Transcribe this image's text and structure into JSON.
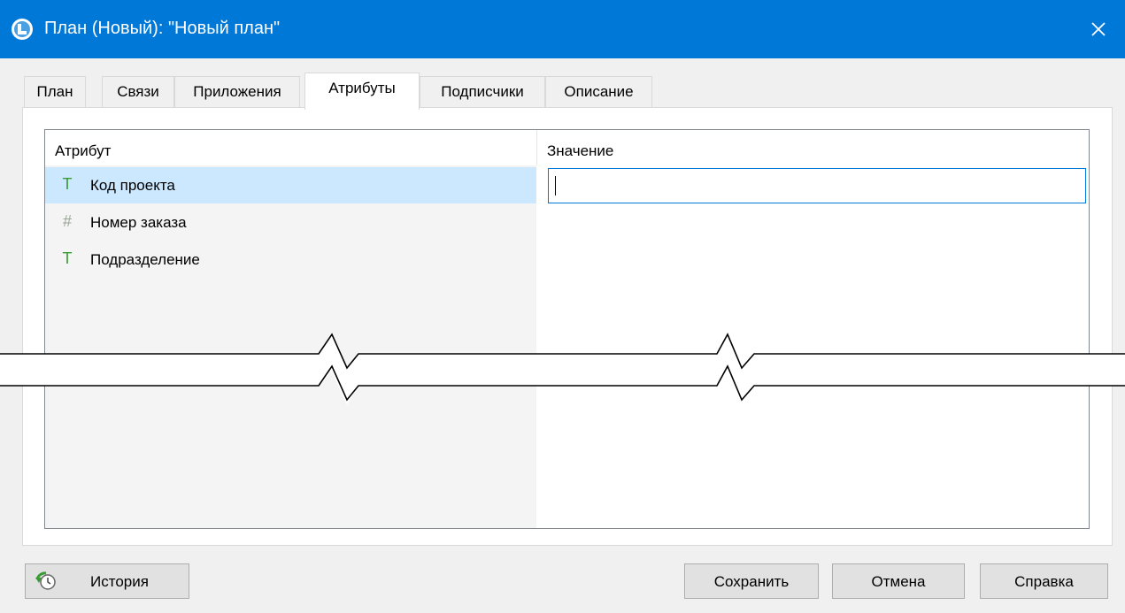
{
  "window": {
    "title": "План (Новый): \"Новый план\"",
    "icon": "app-logo-icon",
    "close_icon": "close-icon",
    "accent_color": "#0078d7"
  },
  "tabs": [
    {
      "label": "План",
      "active": false
    },
    {
      "label": "Связи",
      "active": false
    },
    {
      "label": "Приложения",
      "active": false
    },
    {
      "label": "Атрибуты",
      "active": true
    },
    {
      "label": "Подписчики",
      "active": false
    },
    {
      "label": "Описание",
      "active": false
    }
  ],
  "grid": {
    "columns": [
      "Атрибут",
      "Значение"
    ],
    "rows": [
      {
        "icon": "text-type-icon",
        "glyph": "T",
        "label": "Код проекта",
        "value": "",
        "selected": true
      },
      {
        "icon": "number-type-icon",
        "glyph": "#",
        "label": "Номер заказа",
        "value": "",
        "selected": false
      },
      {
        "icon": "text-type-icon",
        "glyph": "T",
        "label": "Подразделение",
        "value": "",
        "selected": false
      }
    ]
  },
  "buttons": {
    "history": {
      "label": "История",
      "icon": "history-icon"
    },
    "save": "Сохранить",
    "cancel": "Отмена",
    "help": "Справка"
  }
}
